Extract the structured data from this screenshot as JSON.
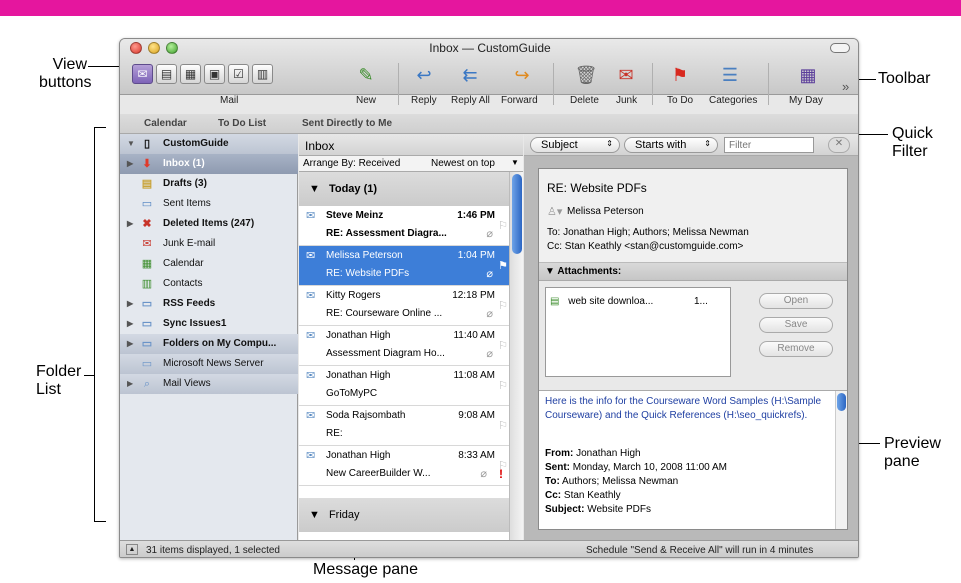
{
  "window": {
    "title": "Inbox — CustomGuide"
  },
  "toolbar": {
    "mail_label": "Mail",
    "new_label": "New",
    "reply_label": "Reply",
    "reply_all_label": "Reply All",
    "forward_label": "Forward",
    "delete_label": "Delete",
    "junk_label": "Junk",
    "todo_label": "To Do",
    "categories_label": "Categories",
    "myday_label": "My Day",
    "more": "»"
  },
  "tabs": {
    "calendar": "Calendar",
    "todo_list": "To Do List",
    "sent_directly": "Sent Directly to Me"
  },
  "folders": [
    {
      "label": "CustomGuide",
      "icon": "computer-icon"
    },
    {
      "label": "Inbox (1)",
      "icon": "inbox-icon"
    },
    {
      "label": "Drafts (3)",
      "icon": "drafts-icon"
    },
    {
      "label": "Sent Items",
      "icon": "sent-icon"
    },
    {
      "label": "Deleted Items (247)",
      "icon": "trash-icon"
    },
    {
      "label": "Junk E-mail",
      "icon": "junk-icon"
    },
    {
      "label": "Calendar",
      "icon": "calendar-icon"
    },
    {
      "label": "Contacts",
      "icon": "contacts-icon"
    },
    {
      "label": "RSS Feeds",
      "icon": "folder-icon"
    },
    {
      "label": "Sync Issues1",
      "icon": "folder-icon"
    },
    {
      "label": "Folders on My Compu...",
      "icon": "folder-icon"
    },
    {
      "label": "Microsoft News Server",
      "icon": "news-icon"
    },
    {
      "label": "Mail Views",
      "icon": "search-folder-icon"
    }
  ],
  "message_pane": {
    "header": "Inbox",
    "arrange_by": "Arrange By: Received",
    "order": "Newest on top",
    "group_today": "Today (1)",
    "group_friday": "Friday",
    "messages": [
      {
        "from": "Steve Meinz",
        "time": "1:46 PM",
        "subject": "RE: Assessment Diagra..."
      },
      {
        "from": "Melissa Peterson",
        "time": "1:04 PM",
        "subject": "RE: Website PDFs"
      },
      {
        "from": "Kitty Rogers",
        "time": "12:18 PM",
        "subject": "RE: Courseware Online ..."
      },
      {
        "from": "Jonathan High",
        "time": "11:40 AM",
        "subject": "Assessment Diagram Ho..."
      },
      {
        "from": "Jonathan High",
        "time": "11:08 AM",
        "subject": "GoToMyPC"
      },
      {
        "from": "Soda Rajsombath",
        "time": "9:08 AM",
        "subject": "RE:"
      },
      {
        "from": "Jonathan High",
        "time": "8:33 AM",
        "subject": "New CareerBuilder W..."
      }
    ]
  },
  "quick_filter": {
    "field": "Subject",
    "op": "Starts with",
    "placeholder": "Filter"
  },
  "preview": {
    "subject": "RE: Website PDFs",
    "sender": "Melissa Peterson",
    "to": "To: Jonathan High; Authors; Melissa Newman",
    "cc": "Cc: Stan Keathly <stan@customguide.com>",
    "attachments_label": "Attachments:",
    "attachment_name": "web site downloa...",
    "attachment_size": "1...",
    "open": "Open",
    "save": "Save",
    "remove": "Remove",
    "body_text": "Here is the info for the Courseware Word Samples (H:\\Sample Courseware) and the Quick References (H:\\seo_quickrefs).",
    "from_label": "From:",
    "from_value": "Jonathan High",
    "sent_label": "Sent:",
    "sent_value": "Monday, March 10, 2008 11:00 AM",
    "to_label": "To:",
    "to_value": "Authors; Melissa Newman",
    "cc_label": "Cc:",
    "cc_value": "Stan Keathly",
    "subject_label": "Subject:",
    "subject_value": "Website PDFs"
  },
  "status": {
    "left": "31 items displayed, 1 selected",
    "right": "Schedule \"Send & Receive All\" will run in 4 minutes"
  },
  "callouts": {
    "view_buttons_1": "View",
    "view_buttons_2": "buttons",
    "toolbar": "Toolbar",
    "quick_filter_1": "Quick",
    "quick_filter_2": "Filter",
    "folder_list_1": "Folder",
    "folder_list_2": "List",
    "preview_pane_1": "Preview",
    "preview_pane_2": "pane",
    "message_pane": "Message pane"
  },
  "colors": {
    "accent_bar": "#e5169e",
    "selection": "#3d7ed8"
  }
}
